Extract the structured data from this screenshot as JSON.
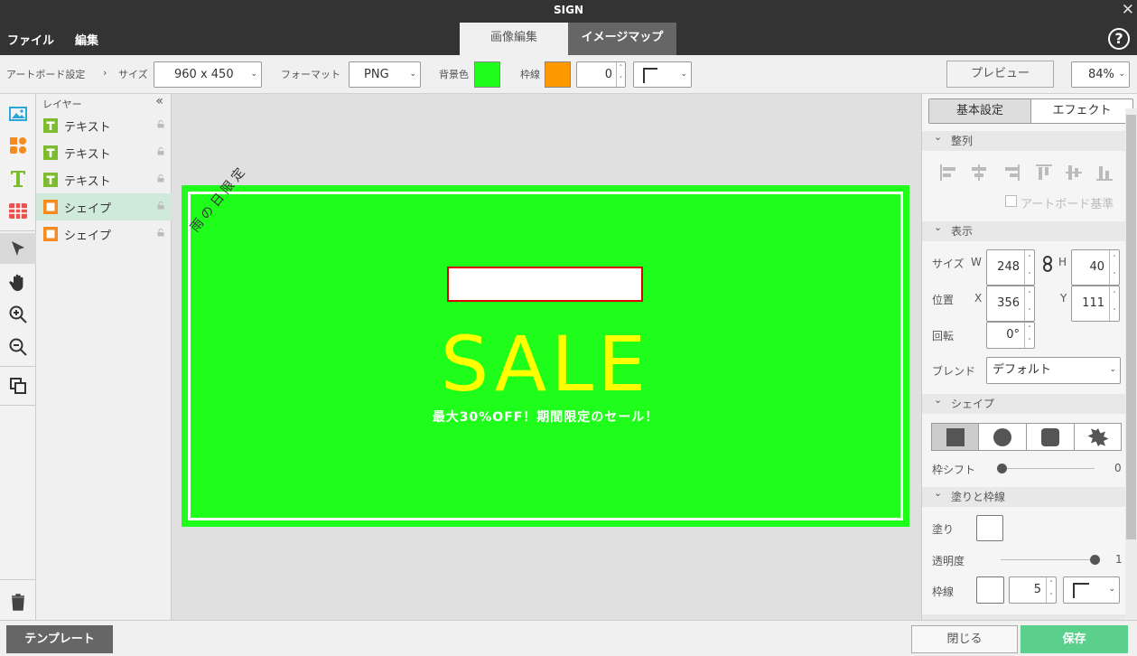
{
  "app": {
    "title": "SIGN"
  },
  "menu": {
    "file": "ファイル",
    "edit": "編集"
  },
  "mode_tabs": {
    "image_edit": "画像編集",
    "image_map": "イメージマップ"
  },
  "toolbar": {
    "artboard_label": "アートボード設定",
    "breadcrumb_sep": "›",
    "size_label": "サイズ",
    "size_value": "960 x 450",
    "format_label": "フォーマット",
    "format_value": "PNG",
    "bg_label": "背景色",
    "border_label": "枠線",
    "border_width": "0",
    "preview": "プレビュー",
    "zoom": "84%"
  },
  "colors": {
    "bg": "#1efe1a",
    "border": "#ff9900",
    "sale": "#ffff00",
    "accent": "#5bcf8c",
    "rect_border": "#dd0000"
  },
  "layers": {
    "header": "レイヤー",
    "collapse": "«",
    "items": [
      {
        "type": "text",
        "label": "テキスト"
      },
      {
        "type": "text",
        "label": "テキスト"
      },
      {
        "type": "text",
        "label": "テキスト"
      },
      {
        "type": "shape",
        "label": "シェイプ"
      },
      {
        "type": "shape",
        "label": "シェイプ"
      }
    ]
  },
  "canvas": {
    "ribbon": "雨の日限定",
    "sale": "SALE",
    "subtitle": "最大30%OFF！期間限定のセール！"
  },
  "panel": {
    "tab_basic": "基本設定",
    "tab_effect": "エフェクト",
    "align_header": "整列",
    "artboard_base": "アートボード基準",
    "display_header": "表示",
    "size_label": "サイズ",
    "w_label": "W",
    "w_value": "248",
    "h_label": "H",
    "h_value": "40",
    "pos_label": "位置",
    "x_label": "X",
    "x_value": "356",
    "y_label": "Y",
    "y_value": "111",
    "rot_label": "回転",
    "rot_value": "0°",
    "blend_label": "ブレンド",
    "blend_value": "デフォルト",
    "shape_header": "シェイプ",
    "frame_shift_label": "枠シフト",
    "frame_shift_value": "0",
    "fill_header": "塗りと枠線",
    "fill_label": "塗り",
    "opacity_label": "透明度",
    "opacity_value": "1",
    "stroke_label": "枠線",
    "stroke_value": "5"
  },
  "bottom": {
    "template": "テンプレート",
    "close": "閉じる",
    "save": "保存"
  }
}
